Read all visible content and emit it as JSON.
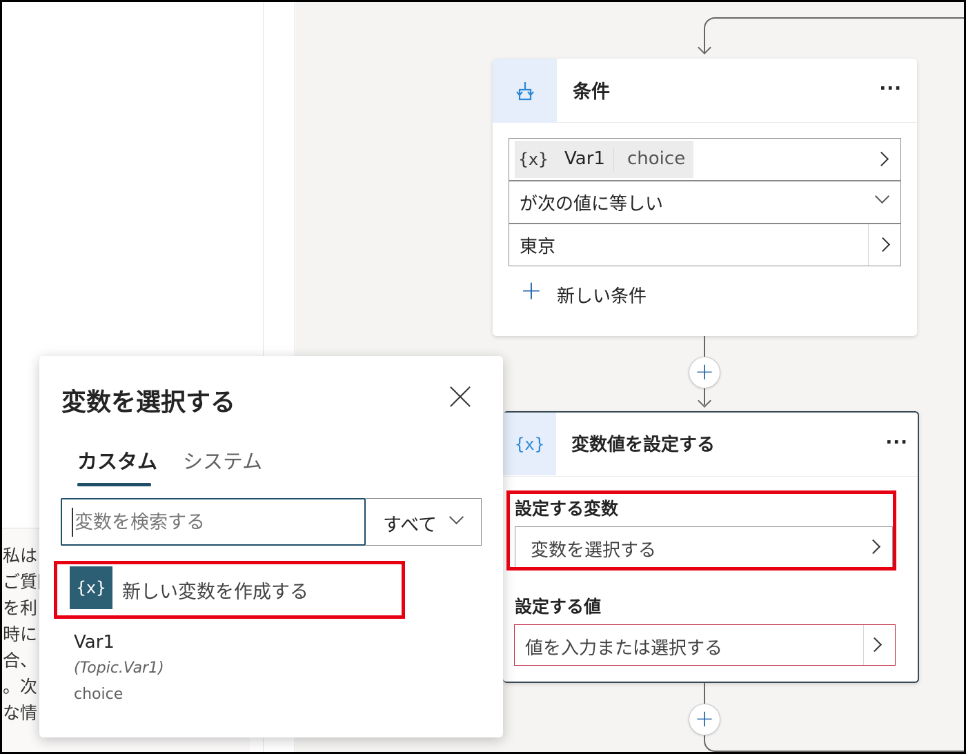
{
  "left_panel": {
    "lines": [
      "私は",
      "ご質問",
      "を利",
      "時に",
      "合、",
      "。次",
      "な情"
    ]
  },
  "condition_card": {
    "title": "条件",
    "more": "...",
    "variable_chip": {
      "icon": "{x}",
      "name": "Var1",
      "type": "choice"
    },
    "operator": "が次の値に等しい",
    "value": "東京",
    "add_condition": "新しい条件"
  },
  "connector": {
    "add_node": "+"
  },
  "set_variable_card": {
    "icon": "{x}",
    "title": "変数値を設定する",
    "more": "...",
    "variable_label": "設定する変数",
    "variable_placeholder": "変数を選択する",
    "value_label": "設定する値",
    "value_placeholder": "値を入力または選択する"
  },
  "dialog": {
    "title": "変数を選択する",
    "tabs": [
      {
        "label": "カスタム",
        "active": true
      },
      {
        "label": "システム",
        "active": false
      }
    ],
    "search": {
      "placeholder": "変数を検索する",
      "value": ""
    },
    "filter": {
      "selected": "すべて"
    },
    "new_variable": {
      "icon": "{x}",
      "label": "新しい変数を作成する"
    },
    "variables": [
      {
        "name": "Var1",
        "path": "(Topic.Var1)",
        "type": "choice"
      }
    ]
  },
  "colors": {
    "highlight": "#e60012",
    "accent": "#1f4e68",
    "icon_blue": "#2b88d8",
    "node_icon_bg": "#e5eefa",
    "error_border": "#c4314b"
  }
}
